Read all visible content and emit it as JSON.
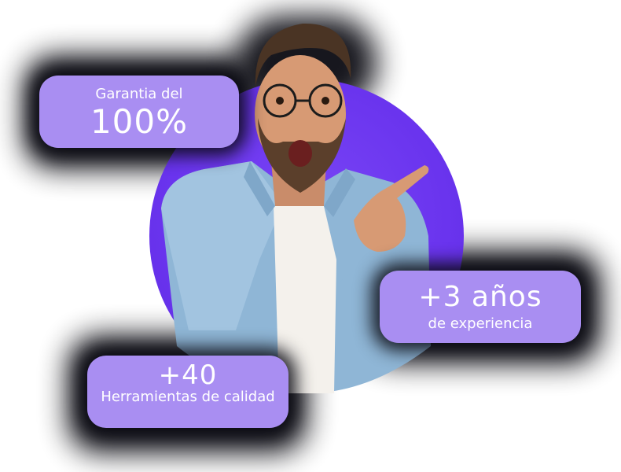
{
  "badges": {
    "guarantee": {
      "line1": "Garantia del",
      "line2": "100%"
    },
    "experience": {
      "line1": "+3 años",
      "line2": "de experiencia"
    },
    "tools": {
      "line1": "+40",
      "line2": "Herramientas de calidad"
    }
  },
  "colors": {
    "circle": "#6a34ee",
    "badge": "#a98ef2",
    "text": "#ffffff",
    "shadow": "#0b0b12"
  }
}
